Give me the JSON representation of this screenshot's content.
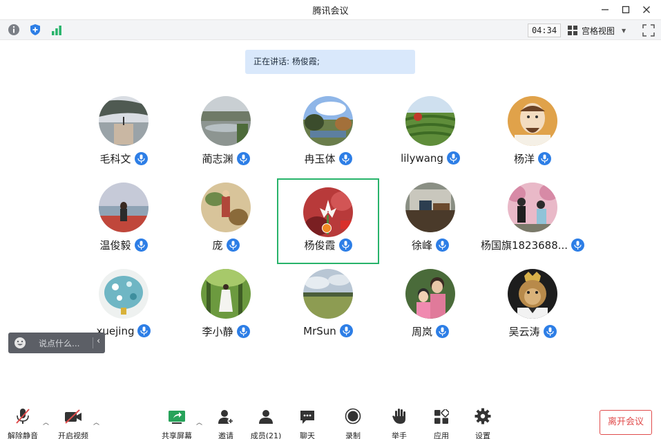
{
  "window": {
    "title": "腾讯会议"
  },
  "topbar": {
    "info_icon": "info-icon",
    "shield_icon": "shield-icon",
    "signal_icon": "signal-icon",
    "timer": "04:34",
    "view_label": "宫格视图"
  },
  "speaking": {
    "text": "正在讲话: 杨俊霞;"
  },
  "participants": [
    {
      "name": "毛科文"
    },
    {
      "name": "蔺志渊"
    },
    {
      "name": "冉玉体"
    },
    {
      "name": "lilywang"
    },
    {
      "name": "杨洋"
    },
    {
      "name": "温俊毅"
    },
    {
      "name": "庞"
    },
    {
      "name": "杨俊霞"
    },
    {
      "name": "徐峰"
    },
    {
      "name": "杨国旗1823688..."
    },
    {
      "name": "xuejing"
    },
    {
      "name": "李小静"
    },
    {
      "name": "MrSun"
    },
    {
      "name": "周岚"
    },
    {
      "name": "吴云涛"
    }
  ],
  "chat": {
    "placeholder": "说点什么..."
  },
  "bottom": {
    "unmute": "解除静音",
    "start_video": "开启视频",
    "share_screen": "共享屏幕",
    "invite": "邀请",
    "members": "成员(21)",
    "chat": "聊天",
    "record": "录制",
    "raise_hand": "举手",
    "apps": "应用",
    "settings": "设置",
    "leave": "离开会议"
  },
  "colors": {
    "accent": "#2d7ee6",
    "active_border": "#27b36a",
    "leave": "#e04b4b",
    "banner": "#d9e8fb"
  }
}
